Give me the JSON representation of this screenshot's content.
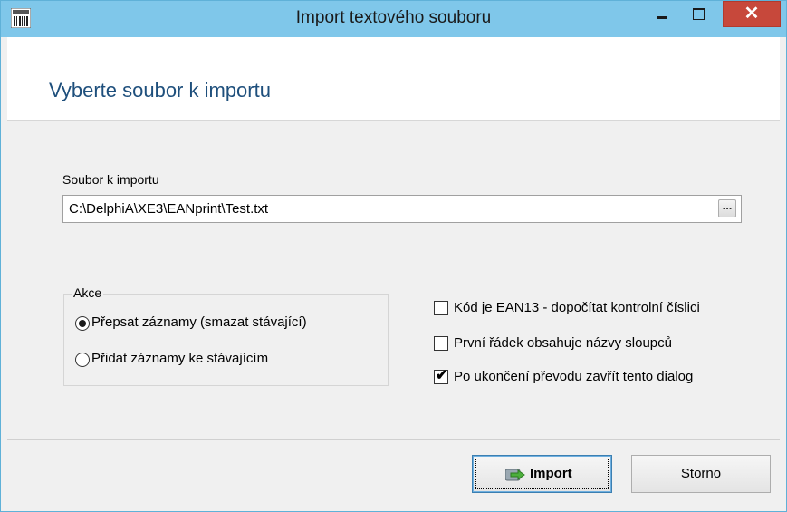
{
  "window": {
    "title": "Import textového souboru",
    "close_glyph": "✕",
    "accent_color": "#7fc7ea",
    "close_color": "#c7483b"
  },
  "header": {
    "title": "Vyberte soubor k importu"
  },
  "file": {
    "label": "Soubor k importu",
    "value": "C:\\DelphiA\\XE3\\EANprint\\Test.txt",
    "browse_glyph": "..."
  },
  "action_group": {
    "title": "Akce",
    "options": [
      {
        "label": "Přepsat záznamy (smazat stávající)",
        "checked": true
      },
      {
        "label": "Přidat záznamy ke stávajícím",
        "checked": false
      }
    ]
  },
  "options": [
    {
      "label": "Kód je EAN13 - dopočítat kontrolní číslici",
      "checked": false
    },
    {
      "label": "První řádek obsahuje názvy sloupců",
      "checked": false
    },
    {
      "label": "Po ukončení převodu zavřít tento dialog",
      "checked": true,
      "mark": "✔"
    }
  ],
  "buttons": {
    "import_label": "Import",
    "cancel_label": "Storno"
  },
  "icons": {
    "app": "barcode-icon",
    "minimize": "minimize-icon",
    "maximize": "maximize-icon",
    "close": "close-icon",
    "import": "import-arrow-icon"
  }
}
